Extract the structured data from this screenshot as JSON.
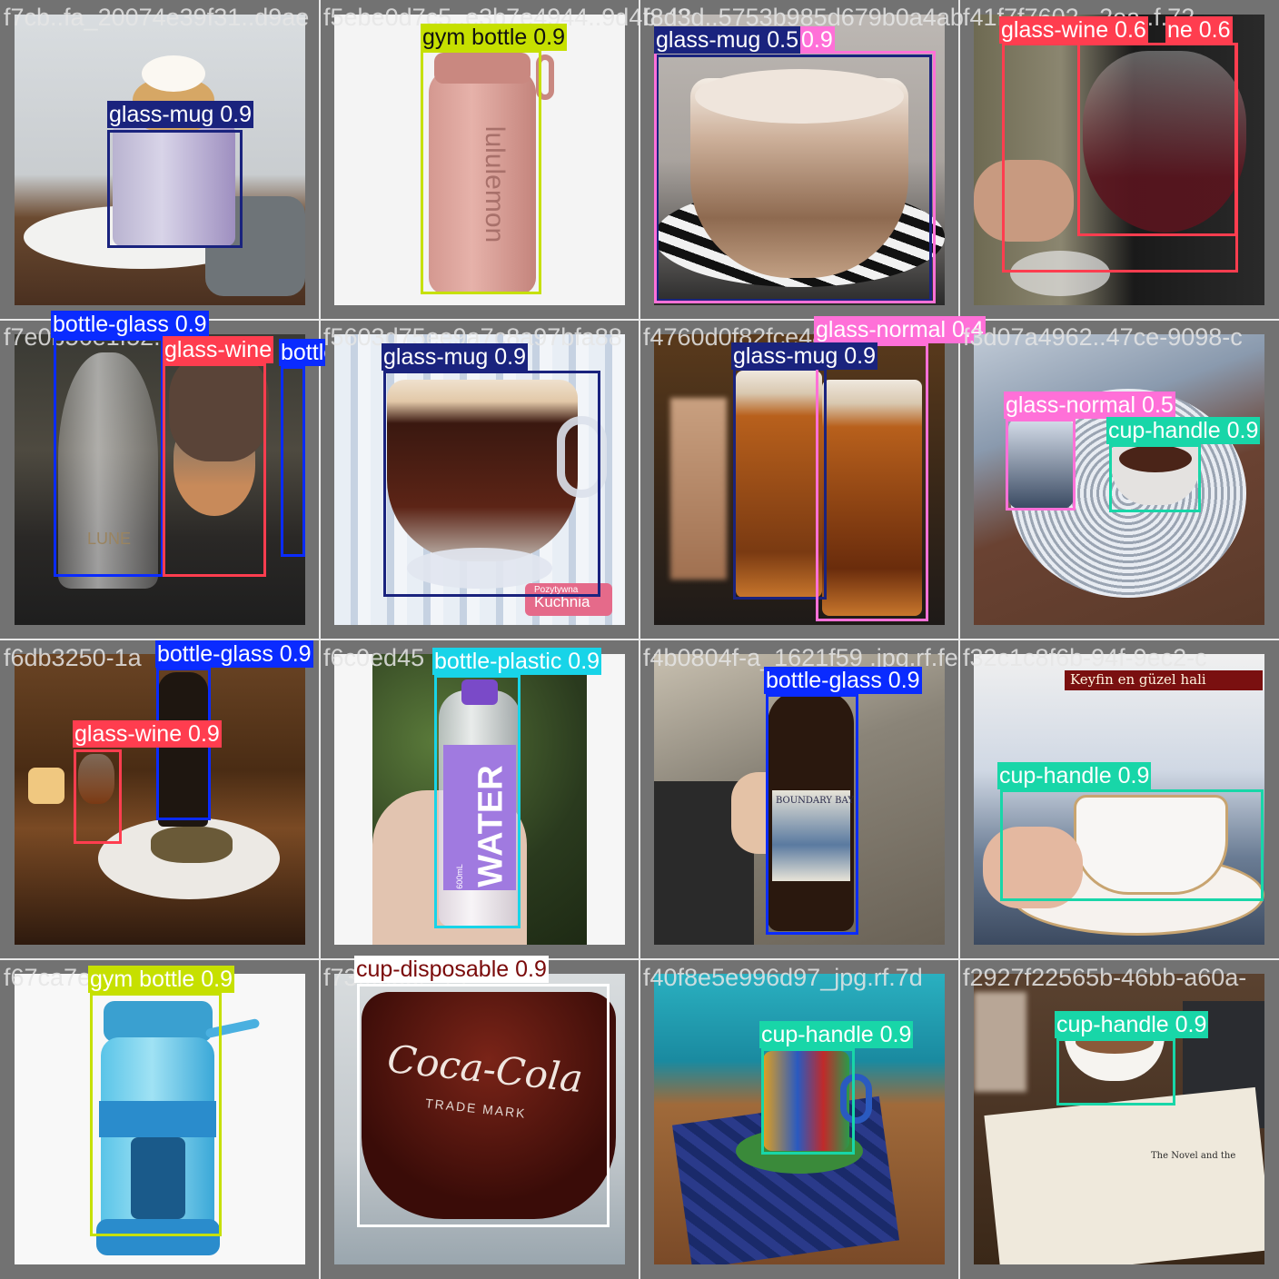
{
  "title": "",
  "colors": {
    "background": "#727272",
    "glass_mug": "#1a237e",
    "gym_bottle": "#c6e000",
    "glass_normal": "#ff70d8",
    "glass_wine": "#ff3d4f",
    "bottle_glass": "#0a2bff",
    "cup_handle": "#18d6a8",
    "bottle_plastic": "#18d4e8",
    "cup_disposable": "#ffffff"
  },
  "tiles": [
    {
      "filename": "f7cb..fa_20074e39f31..d9ae",
      "detections": [
        {
          "label": "glass-mug 0.9"
        }
      ]
    },
    {
      "filename": "f5ebe0d7c5..e3b7e4944..9d4b-48",
      "detections": [
        {
          "label": "gym bottle 0.9"
        }
      ],
      "bottle_text": "lululemon"
    },
    {
      "filename": "f8d3d..5753b985d679b0a4ab",
      "detections": [
        {
          "label": "glass-mug 0.5"
        },
        {
          "label": "0.9"
        }
      ]
    },
    {
      "filename": "f41f7f7602...2ea..f.72",
      "detections": [
        {
          "label": "glass-wine 0.6"
        },
        {
          "label": "ne 0.6"
        }
      ]
    },
    {
      "filename": "f7e0b56e1f52....f-0",
      "detections": [
        {
          "label": "bottle-glass 0.9"
        },
        {
          "label": "glass-wine"
        },
        {
          "label": "bottle-gla"
        }
      ],
      "bottle_text": "LUNE"
    },
    {
      "filename": "f5603d75ee9a7c8a97bfa88",
      "detections": [
        {
          "label": "glass-mug 0.9"
        }
      ],
      "watermark_line1": "Pozytywna",
      "watermark_line2": "Kuchnia"
    },
    {
      "filename": "f4760d0f82fce48",
      "detections": [
        {
          "label": "glass-normal 0.4"
        },
        {
          "label": "glass-mug 0.9"
        }
      ]
    },
    {
      "filename": "f3d07a4962..47ce-9098-c",
      "detections": [
        {
          "label": "glass-normal 0.5"
        },
        {
          "label": "cup-handle 0.9"
        }
      ]
    },
    {
      "filename": "f6db3250-1a",
      "detections": [
        {
          "label": "bottle-glass 0.9"
        },
        {
          "label": "glass-wine 0.9"
        }
      ]
    },
    {
      "filename": "f6c0ed45",
      "detections": [
        {
          "label": "bottle-plastic 0.9"
        }
      ],
      "bottle_text": "WATER",
      "bottle_small": "600mL"
    },
    {
      "filename": "f4b0804f-a_1621f59 .jpg.rf.fe",
      "detections": [
        {
          "label": "bottle-glass 0.9"
        }
      ],
      "bottle_text": "BOUNDARY BAY"
    },
    {
      "filename": "f32c1c8f6b-94f-9ec2-c",
      "detections": [
        {
          "label": "cup-handle 0.9"
        }
      ],
      "banner": "Keyfin en güzel hali"
    },
    {
      "filename": "f67ca7e",
      "detections": [
        {
          "label": "gym bottle 0.9"
        }
      ]
    },
    {
      "filename": "f73...b352-14",
      "detections": [
        {
          "label": "cup-disposable 0.9"
        }
      ],
      "brand": "Coca-Cola",
      "brand_sub": "TRADE MARK"
    },
    {
      "filename": "f40f8e5e996d97_jpg.rf.7d",
      "detections": [
        {
          "label": "cup-handle 0.9"
        }
      ]
    },
    {
      "filename": "f2927f22565b-46bb-a60a-",
      "detections": [
        {
          "label": "cup-handle 0.9"
        }
      ],
      "book_heading": "The Novel and the"
    }
  ]
}
